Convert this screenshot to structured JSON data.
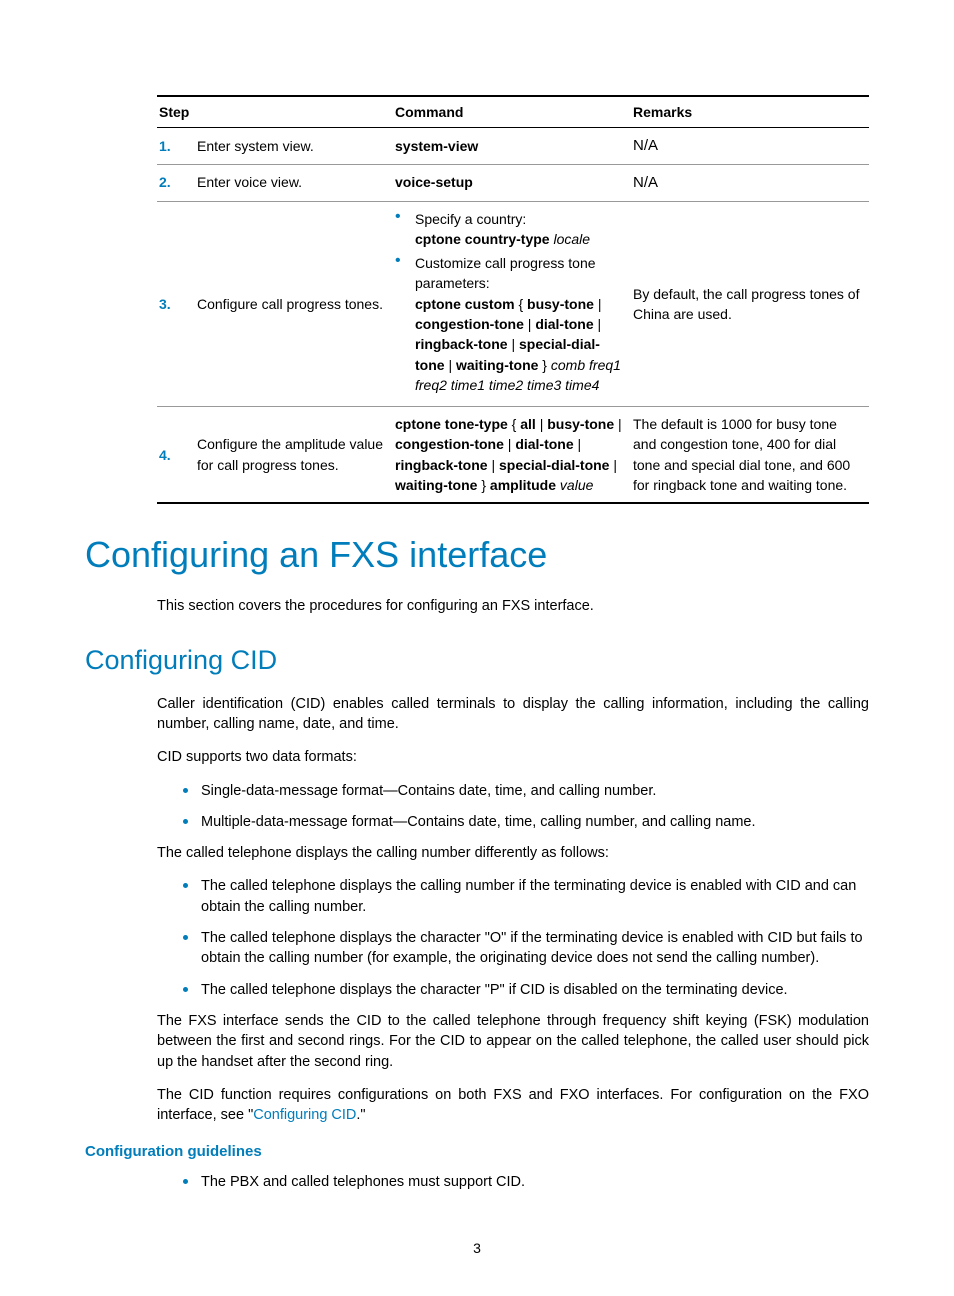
{
  "table": {
    "headers": [
      "Step",
      "Command",
      "Remarks"
    ],
    "rows": [
      {
        "num": "1.",
        "desc": "Enter system view.",
        "cmd_plain_bold": "system-view",
        "remarks": "N/A"
      },
      {
        "num": "2.",
        "desc": "Enter voice view.",
        "cmd_plain_bold": "voice-setup",
        "remarks": "N/A"
      },
      {
        "num": "3.",
        "desc": "Configure call progress tones.",
        "bullets": [
          {
            "intro": "Specify a country:",
            "cmd_bold": "cptone country-type",
            "cmd_italic": " locale"
          },
          {
            "intro": "Customize call progress tone parameters:",
            "cmd_bold": "cptone custom",
            "cmd_mid": " { ",
            "cmd_bold2": "busy-tone",
            "cmd_mid2": " | ",
            "cmd_bold3": "congestion-tone",
            "cmd_mid3": " | ",
            "cmd_bold4": "dial-tone",
            "cmd_mid4": " | ",
            "cmd_bold5": "ringback-tone",
            "cmd_mid5": " | ",
            "cmd_bold6": "special-dial-tone",
            "cmd_mid6": " | ",
            "cmd_bold7": "waiting-tone",
            "cmd_mid7": " } ",
            "cmd_italic": "comb freq1 freq2 time1 time2 time3 time4"
          }
        ],
        "remarks": "By default, the call progress tones of China are used."
      },
      {
        "num": "4.",
        "desc": "Configure the amplitude value for call progress tones.",
        "cmd4_bold1": "cptone tone-type",
        "cmd4_t1": " { ",
        "cmd4_bold2": "all",
        "cmd4_t2": " | ",
        "cmd4_bold3": "busy-tone",
        "cmd4_t3": " | ",
        "cmd4_bold4": "congestion-tone",
        "cmd4_t4": " | ",
        "cmd4_bold5": "dial-tone",
        "cmd4_t5": " | ",
        "cmd4_bold6": "ringback-tone",
        "cmd4_t6": " | ",
        "cmd4_bold7": "special-dial-tone",
        "cmd4_t7": " | ",
        "cmd4_bold8": "waiting-tone",
        "cmd4_t8": " } ",
        "cmd4_bold9": "amplitude",
        "cmd4_italic": " value",
        "remarks": "The default is 1000 for busy tone and congestion tone, 400 for dial tone and special dial tone, and 600 for ringback tone and waiting tone."
      }
    ]
  },
  "h1": "Configuring an FXS interface",
  "intro_p": "This section covers the procedures for configuring an FXS interface.",
  "h2": "Configuring CID",
  "cid_p1": "Caller identification (CID) enables called terminals to display the calling information, including the calling number, calling name, date, and time.",
  "cid_p2": "CID supports two data formats:",
  "cid_list1": [
    "Single-data-message format—Contains date, time, and calling number.",
    "Multiple-data-message format—Contains date, time, calling number, and calling name."
  ],
  "cid_p3": "The called telephone displays the calling number differently as follows:",
  "cid_list2": [
    "The called telephone displays the calling number if the terminating device is enabled with CID and can obtain the calling number.",
    "The called telephone displays the character \"O\" if the terminating device is enabled with CID but fails to obtain the calling number (for example, the originating device does not send the calling number).",
    "The called telephone displays the character \"P\" if CID is disabled on the terminating device."
  ],
  "cid_p4": "The FXS interface sends the CID to the called telephone through frequency shift keying (FSK) modulation between the first and second rings. For the CID to appear on the called telephone, the called user should pick up the handset after the second ring.",
  "cid_p5_a": "The CID function requires configurations on both FXS and FXO interfaces. For configuration on the FXO interface, see \"",
  "cid_p5_link": "Configuring CID",
  "cid_p5_b": ".\"",
  "h3": "Configuration guidelines",
  "guide_list": [
    "The PBX and called telephones must support CID."
  ],
  "pagenum": "3"
}
